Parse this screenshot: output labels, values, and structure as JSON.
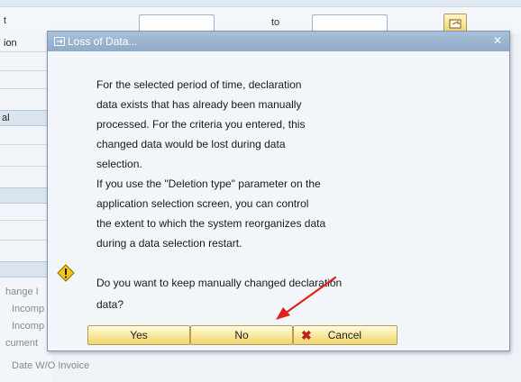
{
  "background": {
    "label_top": "t",
    "label_to": "to",
    "label_ion": "ion",
    "section_al": "al",
    "items": [
      "hange I",
      "Incomp",
      "Incomp",
      "cument",
      "Date W/O Invoice"
    ]
  },
  "dialog": {
    "title": "Loss of Data...",
    "paragraph_lines": [
      "For the selected period of time, declaration",
      "data exists that has already been manually",
      "processed. For the criteria you entered, this",
      "changed data would be lost during data",
      "selection.",
      "If you use the \"Deletion type\" parameter on the",
      "application selection screen, you can control",
      "the extent to which the system reorganizes data",
      "during a data selection restart."
    ],
    "question_lines": [
      "Do you want to keep manually changed declaration",
      "data?"
    ],
    "buttons": {
      "yes": "Yes",
      "no": "No",
      "cancel": "Cancel"
    }
  },
  "colors": {
    "annotation_arrow": "#e0201a",
    "button_fill": "#f8e79a",
    "titlebar": "#9bb5d0"
  }
}
